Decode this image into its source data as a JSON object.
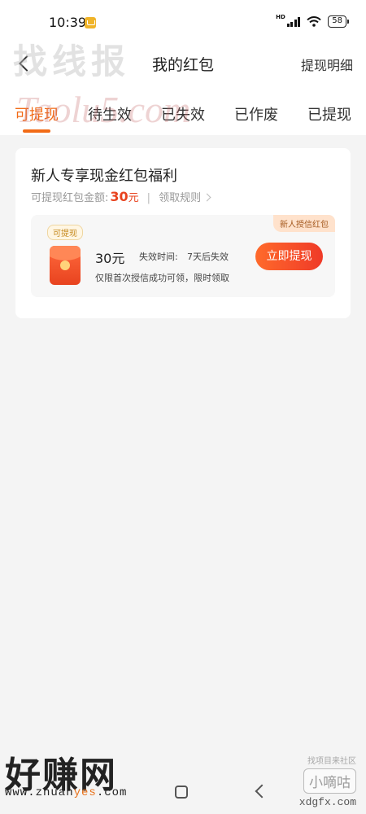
{
  "status_bar": {
    "time": "10:39",
    "network_label": "HD",
    "battery": "58"
  },
  "header": {
    "title": "我的红包",
    "right_link": "提现明细",
    "back_icon": "chevron-left-icon"
  },
  "tabs": [
    {
      "label": "可提现",
      "active": true
    },
    {
      "label": "待生效",
      "active": false
    },
    {
      "label": "已失效",
      "active": false
    },
    {
      "label": "已作废",
      "active": false
    },
    {
      "label": "已提现",
      "active": false
    }
  ],
  "card": {
    "title": "新人专享现金红包福利",
    "amount_label": "可提现红包金额:",
    "amount_value": "30",
    "amount_unit": "元",
    "separator": "|",
    "rules_link": "领取规则",
    "item": {
      "status_tag": "可提现",
      "corner_tag": "新人授信红包",
      "amount": "30元",
      "expire_label": "失效时间:",
      "expire_value": "7天后失效",
      "note": "仅限首次授信成功可领，限时领取",
      "button": "立即提现"
    }
  },
  "watermarks": {
    "top": "找线报",
    "mid": "Taolu5.com",
    "bottom_left": "好赚网",
    "bottom_left_url_pre": "www.zhuan",
    "bottom_left_url_hi": "yes",
    "bottom_left_url_post": ".com",
    "bottom_right_small": "找项目来社区",
    "bottom_right": "小嘀咕",
    "bottom_right_url": "xdgfx.com"
  },
  "colors": {
    "accent": "#f26b16",
    "amount_red": "#e8431f",
    "button_gradient_start": "#ff6a2b",
    "button_gradient_end": "#ef3a28"
  }
}
